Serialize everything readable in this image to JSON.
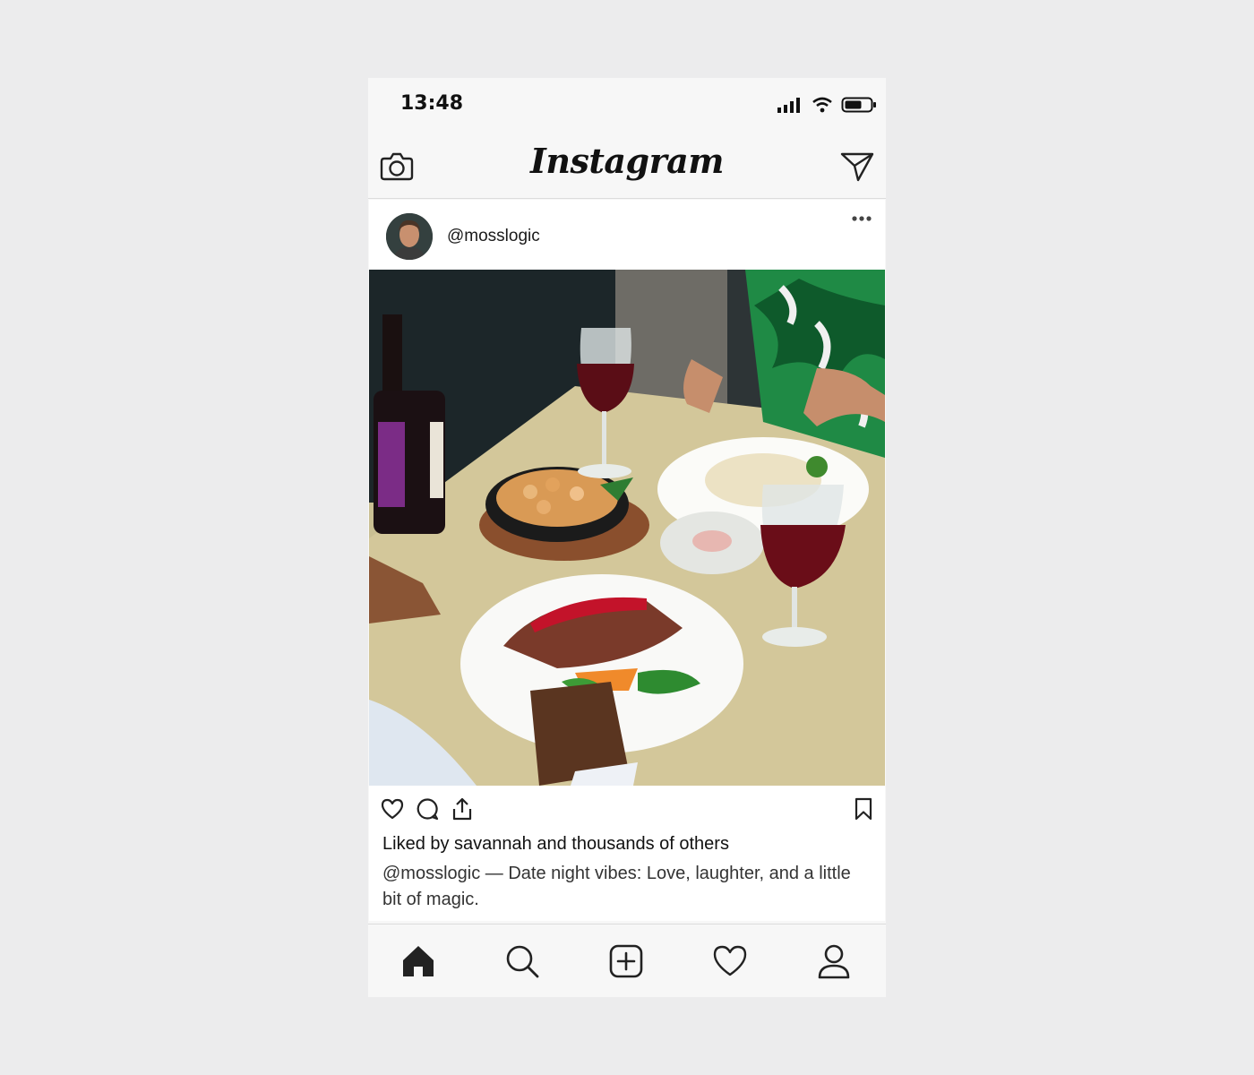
{
  "status_bar": {
    "time": "13:48"
  },
  "header": {
    "logo": "Instagram",
    "camera_icon": "camera-icon",
    "dm_icon": "paper-plane-icon"
  },
  "post": {
    "username": "@mosslogic",
    "more_icon": "ellipsis-icon",
    "image_description_icon": "photo",
    "actions": [
      "heart-icon",
      "comment-icon",
      "share-icon",
      "bookmark-icon"
    ],
    "liked_by": "Liked by savannah and thousands of others",
    "caption": "@mosslogic — Date night vibes: Love, laughter, and a little bit of magic."
  },
  "bottom_nav": {
    "items": [
      "home-icon",
      "search-icon",
      "add-post-icon",
      "activity-heart-icon",
      "profile-icon"
    ]
  },
  "colors": {
    "background": "#ececed",
    "phone_bg": "#f7f7f7",
    "text": "#111111"
  }
}
